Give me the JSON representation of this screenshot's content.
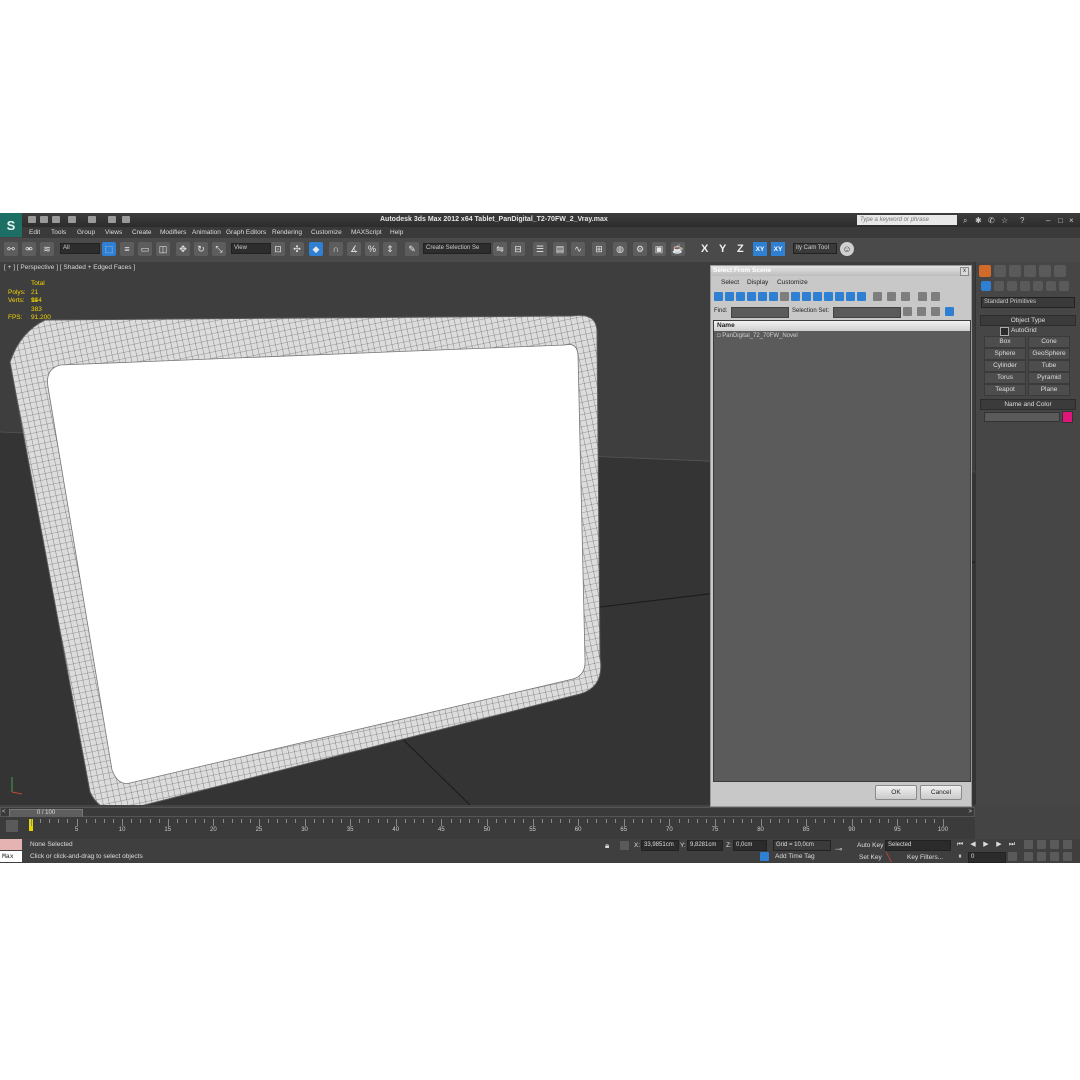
{
  "app": {
    "logo": "S",
    "title": "Autodesk 3ds Max  2012 x64     Tablet_PanDigital_T2-70FW_2_Vray.max",
    "search_placeholder": "Type a keyword or phrase"
  },
  "menu": [
    "Edit",
    "Tools",
    "Group",
    "Views",
    "Create",
    "Modifiers",
    "Animation",
    "Graph Editors",
    "Rendering",
    "Customize",
    "MAXScript",
    "Help"
  ],
  "toolbar": {
    "filter_value": "All",
    "ref_coord_value": "View",
    "selection_set_placeholder": "Create Selection Se",
    "axes": [
      "X",
      "Y",
      "Z"
    ],
    "axis_xy": "XY",
    "axis_xy2": "XY",
    "utility_label": "ity Cam Tool"
  },
  "viewport": {
    "label": "[ + ] [ Perspective ] [ Shaded + Edged Faces ]",
    "stats": {
      "total_label": "Total",
      "polys_label": "Polys:",
      "polys_value": "21 944",
      "verts_label": "Verts:",
      "verts_value": "11 383",
      "fps_label": "FPS:",
      "fps_value": "91.200"
    }
  },
  "dialog": {
    "title": "Select From Scene",
    "close": "x",
    "menu": [
      "Select",
      "Display",
      "Customize"
    ],
    "find_label": "Find:",
    "selection_set_label": "Selection Set:",
    "list_header": "Name",
    "rows": [
      "PanDigital_72_70FW_Novel"
    ],
    "ok": "OK",
    "cancel": "Cancel"
  },
  "command_panel": {
    "category": "Standard Primitives",
    "object_type_title": "Object Type",
    "autogrid": "AutoGrid",
    "primitives": [
      "Box",
      "Cone",
      "Sphere",
      "GeoSphere",
      "Cylinder",
      "Tube",
      "Torus",
      "Pyramid",
      "Teapot",
      "Plane"
    ],
    "name_color_title": "Name and Color",
    "object_color": "#e0157a"
  },
  "timeline": {
    "position": "0 / 100",
    "ticks": [
      "5",
      "10",
      "15",
      "20",
      "25",
      "30",
      "35",
      "40",
      "45",
      "50",
      "55",
      "60",
      "65",
      "70",
      "75",
      "80",
      "85",
      "90",
      "95",
      "100"
    ]
  },
  "status": {
    "maxscript_label": "Max",
    "selection": "None Selected",
    "prompt": "Click or click-and-drag to select objects",
    "x_label": "X:",
    "x_value": "33,9851cm",
    "y_label": "Y:",
    "y_value": "9,8281cm",
    "z_label": "Z:",
    "z_value": "0,0cm",
    "grid": "Grid = 10,0cm",
    "add_time_tag": "Add Time Tag",
    "auto_key": "Auto Key",
    "key_mode": "Selected",
    "set_key": "Set Key",
    "key_filters": "Key Filters...",
    "frame": "0"
  }
}
